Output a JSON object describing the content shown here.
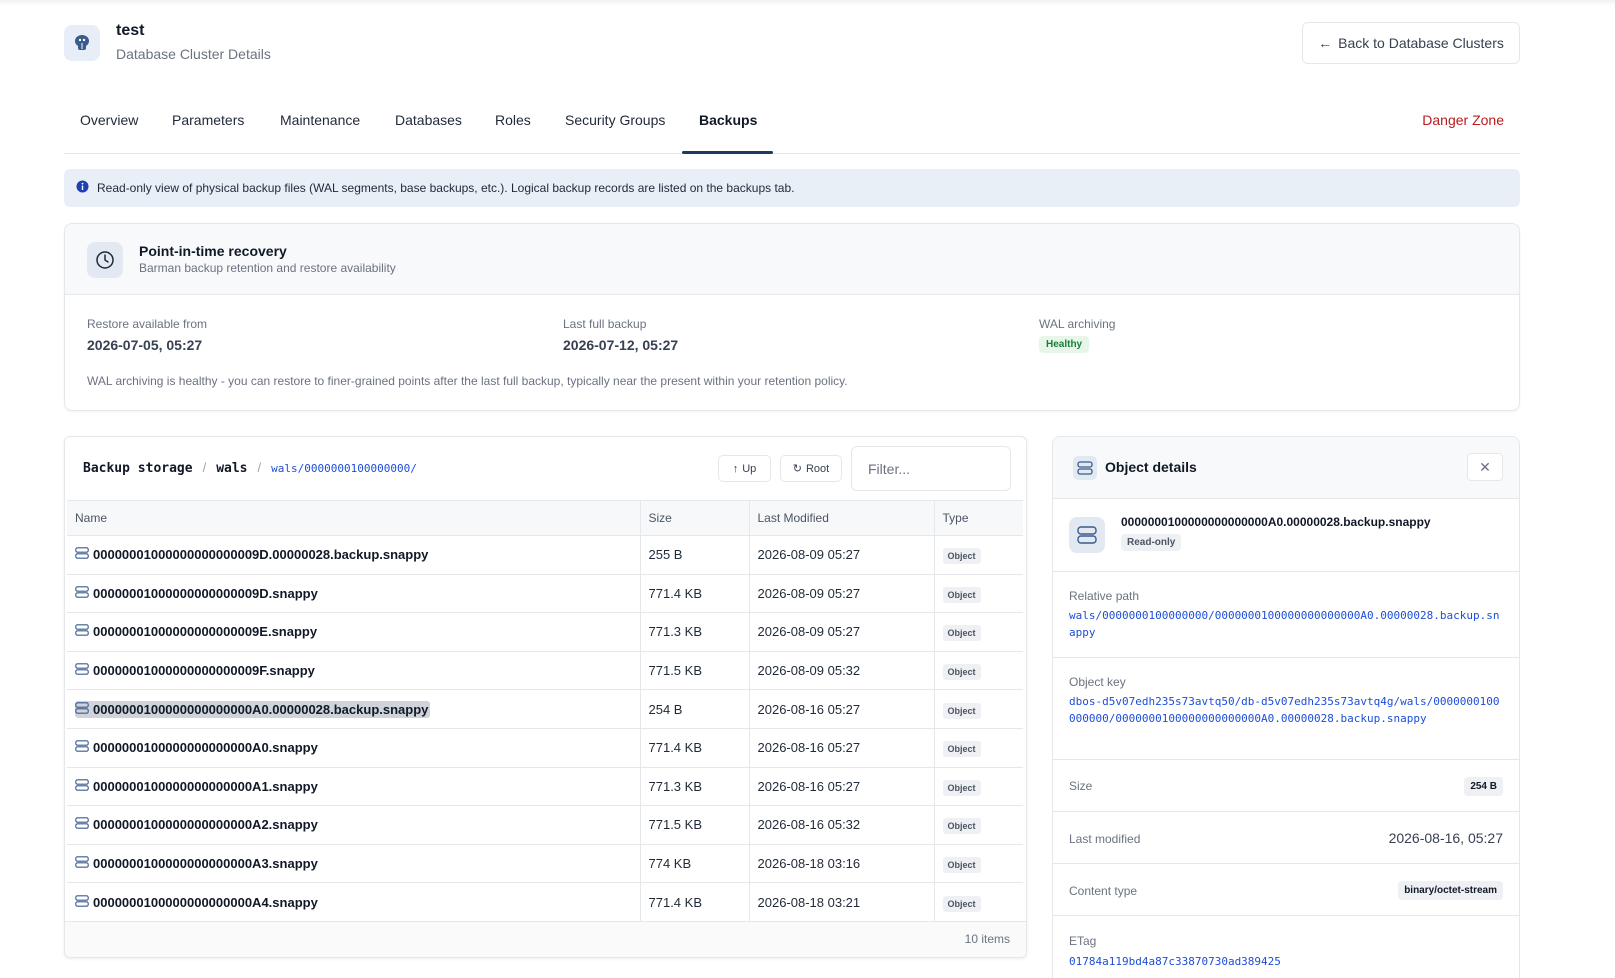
{
  "header": {
    "title": "test",
    "subtitle": "Database Cluster Details",
    "back_label": "Back to Database Clusters"
  },
  "tabs": {
    "items": [
      {
        "label": "Overview"
      },
      {
        "label": "Parameters"
      },
      {
        "label": "Maintenance"
      },
      {
        "label": "Databases"
      },
      {
        "label": "Roles"
      },
      {
        "label": "Security Groups"
      },
      {
        "label": "Backups",
        "active": true
      }
    ],
    "danger_label": "Danger Zone"
  },
  "banner": {
    "text": "Read-only view of physical backup files (WAL segments, base backups, etc.). Logical backup records are listed on the backups tab."
  },
  "pitr": {
    "title": "Point-in-time recovery",
    "subtitle": "Barman backup retention and restore availability",
    "restore_label": "Restore available from",
    "restore_value": "2026-07-05, 05:27",
    "full_label": "Last full backup",
    "full_value": "2026-07-12, 05:27",
    "wal_label": "WAL archiving",
    "wal_status": "Healthy",
    "note": "WAL archiving is healthy - you can restore to finer-grained points after the last full backup, typically near the present within your retention policy."
  },
  "browser": {
    "crumb_root": "Backup storage",
    "crumb_sep": "/",
    "crumb_dir": "wals",
    "crumb_current": "wals/0000000100000000/",
    "up_label": "Up",
    "root_label": "Root",
    "filter_placeholder": "Filter...",
    "columns": [
      "Name",
      "Size",
      "Last Modified",
      "Type"
    ],
    "rows": [
      {
        "name": "00000001000000000000009D.00000028.backup.snappy",
        "size": "255 B",
        "modified": "2026-08-09 05:27",
        "type": "Object"
      },
      {
        "name": "00000001000000000000009D.snappy",
        "size": "771.4 KB",
        "modified": "2026-08-09 05:27",
        "type": "Object"
      },
      {
        "name": "00000001000000000000009E.snappy",
        "size": "771.3 KB",
        "modified": "2026-08-09 05:27",
        "type": "Object"
      },
      {
        "name": "00000001000000000000009F.snappy",
        "size": "771.5 KB",
        "modified": "2026-08-09 05:32",
        "type": "Object"
      },
      {
        "name": "0000000100000000000000A0.00000028.backup.snappy",
        "size": "254 B",
        "modified": "2026-08-16 05:27",
        "type": "Object",
        "selected": true
      },
      {
        "name": "0000000100000000000000A0.snappy",
        "size": "771.4 KB",
        "modified": "2026-08-16 05:27",
        "type": "Object"
      },
      {
        "name": "0000000100000000000000A1.snappy",
        "size": "771.3 KB",
        "modified": "2026-08-16 05:27",
        "type": "Object"
      },
      {
        "name": "0000000100000000000000A2.snappy",
        "size": "771.5 KB",
        "modified": "2026-08-16 05:32",
        "type": "Object"
      },
      {
        "name": "0000000100000000000000A3.snappy",
        "size": "774 KB",
        "modified": "2026-08-18 03:16",
        "type": "Object"
      },
      {
        "name": "0000000100000000000000A4.snappy",
        "size": "771.4 KB",
        "modified": "2026-08-18 03:21",
        "type": "Object"
      }
    ],
    "items_count": "10 items"
  },
  "details": {
    "title": "Object details",
    "object_name": "0000000100000000000000A0.00000028.backup.snappy",
    "readonly": "Read-only",
    "relpath_label": "Relative path",
    "relpath": "wals/0000000100000000/0000000100000000000000A0.00000028.backup.snappy",
    "key_label": "Object key",
    "key": "dbos-d5v07edh235s73avtq50/db-d5v07edh235s73avtq4g/wals/0000000100000000/0000000100000000000000A0.00000028.backup.snappy",
    "size_label": "Size",
    "size": "254 B",
    "modified_label": "Last modified",
    "modified": "2026-08-16, 05:27",
    "ctype_label": "Content type",
    "ctype": "binary/octet-stream",
    "etag_label": "ETag",
    "etag": "01784a119bd4a87c33870730ad389425"
  }
}
